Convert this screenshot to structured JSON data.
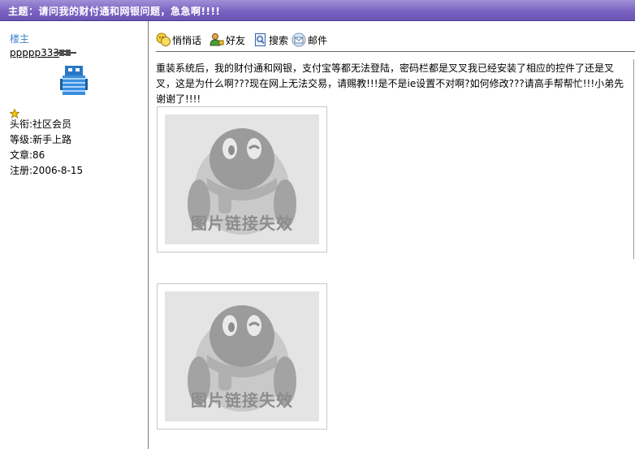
{
  "header": {
    "title": "主题：请问我的财付通和网银问题，急急啊!!!!"
  },
  "author": {
    "role": "楼主",
    "username": "ppppp333",
    "title_line": "头衔:社区会员",
    "level_line": "等级:新手上路",
    "posts_line": "文章:86",
    "reg_line": "注册:2006-8-15"
  },
  "toolbar": {
    "whisper": "悄悄话",
    "friend": "好友",
    "search": "搜索",
    "mail": "邮件"
  },
  "post": {
    "body": "重装系统后，我的财付通和网银，支付宝等都无法登陆，密码栏都是叉叉我已经安装了相应的控件了还是叉叉，这是为什么啊???现在网上无法交易，请赐教!!!是不是ie设置不对啊?如何修改???请高手帮帮忙!!!小弟先谢谢了!!!!"
  },
  "images": [
    {
      "caption": "图片链接失效"
    },
    {
      "caption": "图片链接失效"
    }
  ]
}
